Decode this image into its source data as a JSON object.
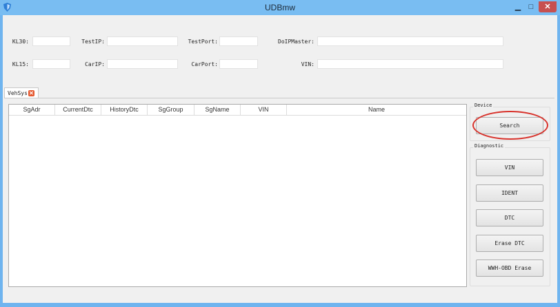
{
  "window": {
    "title": "UDBmw",
    "min_glyph": "▁",
    "max_glyph": "□",
    "close_glyph": "✕",
    "icon": "shield-icon",
    "accent": "#79bdf2"
  },
  "fields": {
    "kl30": {
      "label": "KL30:",
      "value": ""
    },
    "testip": {
      "label": "TestIP:",
      "value": ""
    },
    "testport": {
      "label": "TestPort:",
      "value": ""
    },
    "doipmaster": {
      "label": "DoIPMaster:",
      "value": ""
    },
    "kl15": {
      "label": "KL15:",
      "value": ""
    },
    "carip": {
      "label": "CarIP:",
      "value": ""
    },
    "carport": {
      "label": "CarPort:",
      "value": ""
    },
    "vin": {
      "label": "VIN:",
      "value": ""
    }
  },
  "tab": {
    "label": "VehSys",
    "close_glyph": "✕",
    "close_color": "#e4572e"
  },
  "table": {
    "columns": [
      "SgAdr",
      "CurrentDtc",
      "HistoryDtc",
      "SgGroup",
      "SgName",
      "VIN",
      "Name"
    ],
    "rows": []
  },
  "device_group": {
    "title": "Device",
    "search_label": "Search",
    "highlight_color": "#d8322b"
  },
  "diagnostic_group": {
    "title": "Diagnostic",
    "buttons": [
      "VIN",
      "IDENT",
      "DTC",
      "Erase DTC",
      "WWH-OBD Erase"
    ]
  }
}
